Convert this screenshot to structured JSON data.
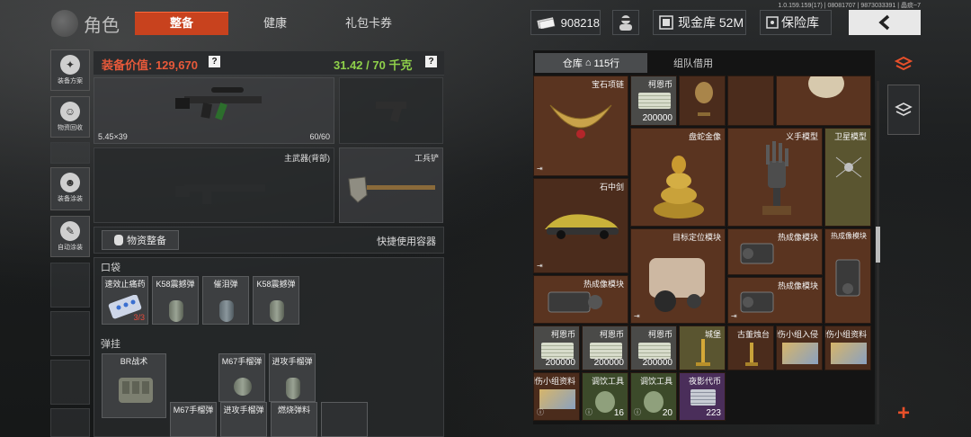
{
  "header": {
    "version": "1.0.159.159(17) | 08081707 | 9873033391 | 晶痰~7",
    "title": "角色",
    "tabs": [
      {
        "label": "整备",
        "active": true
      },
      {
        "label": "健康",
        "active": false
      },
      {
        "label": "礼包卡券",
        "active": false
      }
    ],
    "money": "908218",
    "cash_label": "现金库 52M",
    "safe_label": "保险库"
  },
  "left_nav": [
    {
      "label": "装备方案",
      "icon": "gear-loadout-icon"
    },
    {
      "label": "物资回收",
      "icon": "recycle-icon"
    },
    {
      "label": "装备涂装",
      "icon": "paint-icon"
    },
    {
      "label": "自动涂装",
      "icon": "auto-paint-icon"
    }
  ],
  "equipment": {
    "value_label": "装备价值: 129,670",
    "weight_label": "31.42 / 70 千克",
    "primary_weapon": {
      "caliber": "5.45×39",
      "ammo": "60/60"
    },
    "slot_back": {
      "label": "主武器(背部)"
    },
    "slot_tool": {
      "label": "工兵铲"
    },
    "gather_button": "物资整备",
    "quick_container": "快捷使用容器",
    "pocket_label": "口袋",
    "pockets": [
      {
        "name": "速效止痛药",
        "count": "3/3"
      },
      {
        "name": "K58震撼弹"
      },
      {
        "name": "催泪弹"
      },
      {
        "name": "K58震撼弹"
      }
    ],
    "rig_label": "弹挂",
    "rig_name": "BR战术",
    "rig_items": [
      {
        "name": "M67手榴弹"
      },
      {
        "name": "进攻手榴弹"
      },
      {
        "name": "M67手榴弹"
      },
      {
        "name": "进攻手榴弹"
      },
      {
        "name": "燃烧弹料"
      }
    ]
  },
  "warehouse": {
    "tab_active": "仓库",
    "rows": "115行",
    "tab_other": "组队借用",
    "items": [
      {
        "name": "宝石项链"
      },
      {
        "name": "柯恩币",
        "count": "200000"
      },
      {
        "name": "盘蛇金像"
      },
      {
        "name": "义手模型"
      },
      {
        "name": "卫星模型"
      },
      {
        "name": "石中剑"
      },
      {
        "name": "目标定位模块"
      },
      {
        "name": "热成像模块"
      },
      {
        "name": "热成像模块"
      },
      {
        "name": "热成像模块"
      },
      {
        "name": "热成像模块"
      },
      {
        "name": "柯恩币",
        "count": "200000"
      },
      {
        "name": "柯恩币",
        "count": "200000"
      },
      {
        "name": "柯恩币",
        "count": "200000"
      },
      {
        "name": "城堡"
      },
      {
        "name": "古董烛台"
      },
      {
        "name": "创伤小组入侵"
      },
      {
        "name": "创伤小组资料"
      },
      {
        "name": "创伤小组资料"
      },
      {
        "name": "调饮工具",
        "count": "16"
      },
      {
        "name": "调饮工具",
        "count": "20"
      },
      {
        "name": "夜影代币",
        "count": "223"
      }
    ]
  },
  "colors": {
    "accent": "#c8421e",
    "weight": "#8fd14a",
    "value": "#e8593a"
  }
}
